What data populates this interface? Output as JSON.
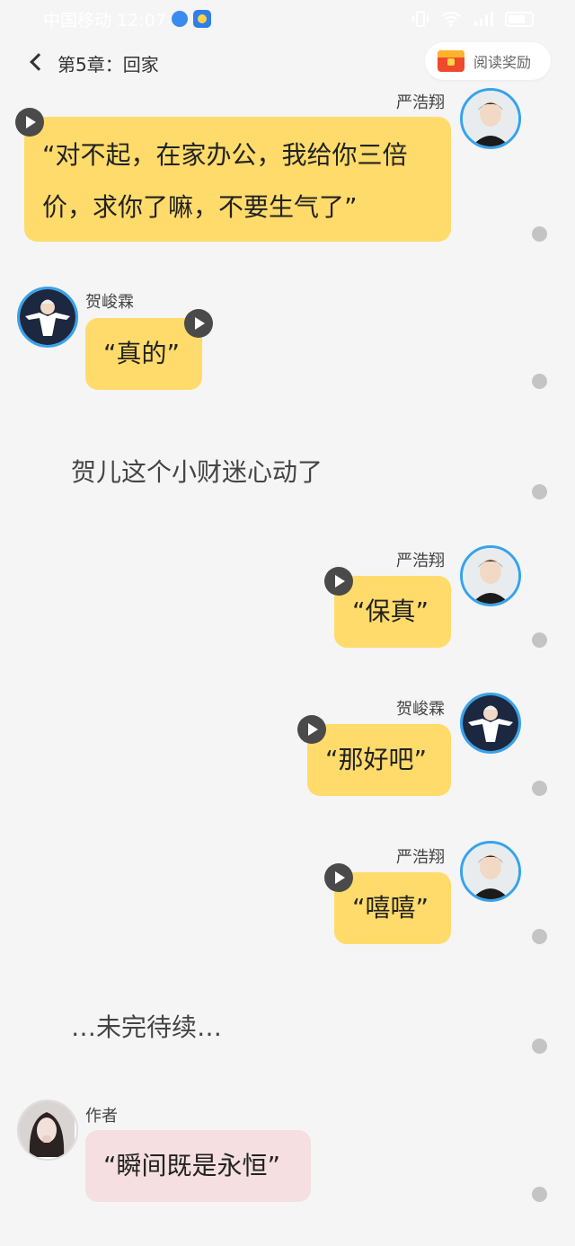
{
  "status_bar": {
    "carrier_time": "中国移动 12:07",
    "icons": [
      "browser-icon",
      "weather-icon",
      "vibrate-icon",
      "wifi-icon",
      "signal-icon",
      "battery-icon"
    ]
  },
  "header": {
    "back_icon": "chevron-left-icon",
    "title": "第5章：回家",
    "reward_label": "阅读奖励",
    "reward_icon": "red-envelope-icon"
  },
  "messages": [
    {
      "speaker": "严浩翔",
      "text": "“对不起，在家办公，我给你三倍价，求你了嘛，不要生气了”",
      "side": "right",
      "audio": true
    },
    {
      "speaker": "贺峻霖",
      "text": "“真的”",
      "side": "left",
      "audio": true
    },
    {
      "narration": "贺儿这个小财迷心动了"
    },
    {
      "speaker": "严浩翔",
      "text": "“保真”",
      "side": "right",
      "audio": true
    },
    {
      "speaker": "贺峻霖",
      "text": "“那好吧”",
      "side": "right",
      "audio": true
    },
    {
      "speaker": "严浩翔",
      "text": "“嘻嘻”",
      "side": "right",
      "audio": true
    },
    {
      "narration": "…未完待续…"
    },
    {
      "speaker": "作者",
      "text": "“瞬间既是永恒”",
      "side": "left",
      "audio": false
    }
  ],
  "colors": {
    "background": "#f5f5f5",
    "bubble": "#ffdb6b",
    "author_bubble": "#f5dfe0",
    "avatar_ring": "#36a3ec"
  }
}
